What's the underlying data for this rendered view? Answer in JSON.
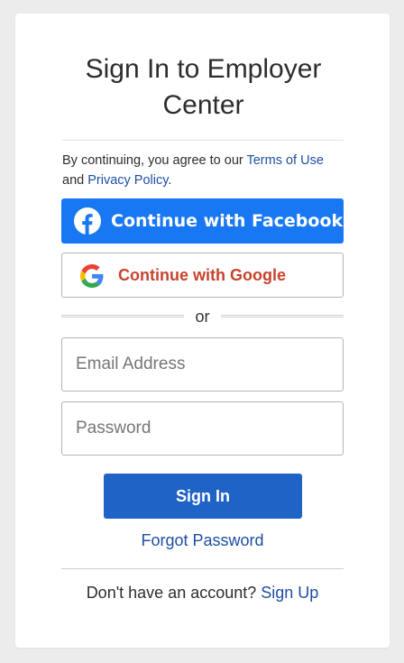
{
  "title": "Sign In to Employer Center",
  "agreement": {
    "prefix": "By continuing, you agree to our ",
    "terms_link": "Terms of Use",
    "and": " and ",
    "privacy_link": "Privacy Policy",
    "suffix": "."
  },
  "buttons": {
    "facebook_label": "Continue with Facebook",
    "google_label": "Continue with Google",
    "signin_label": "Sign In"
  },
  "divider_text": "or",
  "form": {
    "email": {
      "placeholder": "Email Address",
      "value": ""
    },
    "password": {
      "placeholder": "Password",
      "value": ""
    }
  },
  "forgot_link": "Forgot Password",
  "signup": {
    "prompt": "Don't have an account? ",
    "link": "Sign Up"
  },
  "colors": {
    "facebook": "#1877f2",
    "google_text": "#c8432e",
    "primary": "#1f63c6",
    "link": "#1d4fa3"
  },
  "icons": [
    "facebook-icon",
    "google-icon"
  ]
}
